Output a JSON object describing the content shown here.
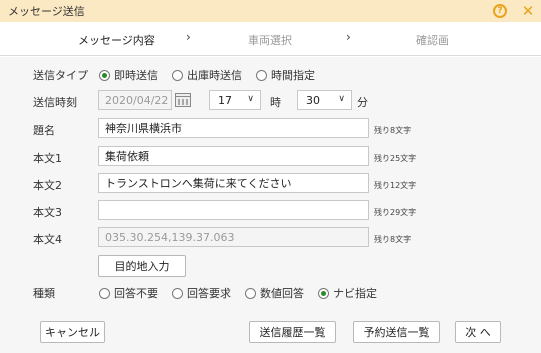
{
  "window": {
    "title": "メッセージ送信",
    "help_icon": "?",
    "close_icon": "✕"
  },
  "steps": {
    "step1": "メッセージ内容",
    "step2": "車両選択",
    "step3": "確認画",
    "arrow": "›"
  },
  "form": {
    "send_type": {
      "label": "送信タイプ",
      "options": [
        "即時送信",
        "出庫時送信",
        "時間指定"
      ],
      "selected": "即時送信"
    },
    "send_time": {
      "label": "送信時刻",
      "date_value": "2020/04/22",
      "hour_value": "17",
      "hour_unit": "時",
      "minute_value": "30",
      "minute_unit": "分"
    },
    "subject": {
      "label": "題名",
      "value": "神奈川県横浜市",
      "remaining": "残り8文字"
    },
    "body1": {
      "label": "本文1",
      "value": "集荷依頼",
      "remaining": "残り25文字"
    },
    "body2": {
      "label": "本文2",
      "value": "トランストロンへ集荷に来てください",
      "remaining": "残り12文字"
    },
    "body3": {
      "label": "本文3",
      "value": "",
      "remaining": "残り29文字"
    },
    "body4": {
      "label": "本文4",
      "value": "035.30.254,139.37.063",
      "remaining": "残り8文字"
    },
    "destination_button": "目的地入力",
    "kind": {
      "label": "種類",
      "options": [
        "回答不要",
        "回答要求",
        "数値回答",
        "ナビ指定"
      ],
      "selected": "ナビ指定"
    }
  },
  "footer": {
    "cancel": "キャンセル",
    "history": "送信履歴一覧",
    "scheduled": "予約送信一覧",
    "next": "次 へ"
  },
  "colors": {
    "titlebar_bg": "#fbe9c3",
    "accent": "#e8a21c",
    "radio_selected": "#2a8a2a"
  }
}
